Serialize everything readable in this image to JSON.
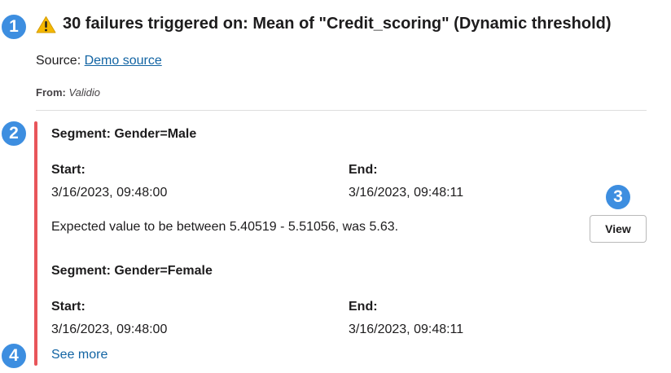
{
  "callouts": [
    "1",
    "2",
    "3",
    "4"
  ],
  "header": {
    "title": "30 failures triggered on: Mean of \"Credit_scoring\" (Dynamic threshold)",
    "icon": "warning-icon"
  },
  "source": {
    "label": "Source:",
    "link_text": "Demo source"
  },
  "from": {
    "label": "From:",
    "value": "Validio"
  },
  "segments": [
    {
      "title": "Segment: Gender=Male",
      "start_label": "Start:",
      "start_value": "3/16/2023, 09:48:00",
      "end_label": "End:",
      "end_value": "3/16/2023, 09:48:11",
      "message": "Expected value to be between 5.40519 - 5.51056, was 5.63.",
      "view_label": "View"
    },
    {
      "title": "Segment: Gender=Female",
      "start_label": "Start:",
      "start_value": "3/16/2023, 09:48:00",
      "end_label": "End:",
      "end_value": "3/16/2023, 09:48:11"
    }
  ],
  "see_more_label": "See more",
  "colors": {
    "accent_bar": "#e8555a",
    "link": "#1264a3",
    "callout_badge": "#3d8ee0",
    "warning": "#f5b800"
  }
}
